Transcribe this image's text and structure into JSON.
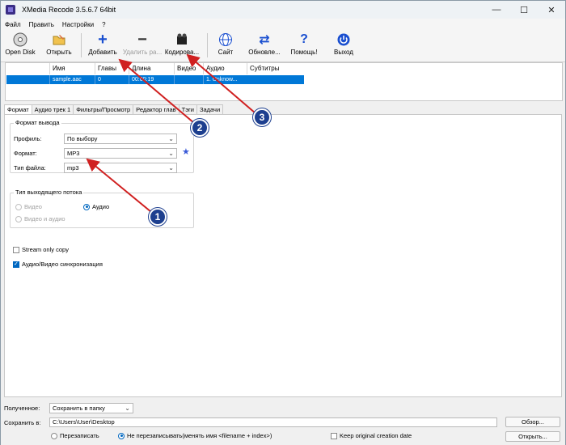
{
  "window": {
    "title": "XMedia Recode 3.5.6.7 64bit"
  },
  "menu": [
    "Файл",
    "Править",
    "Настройки",
    "?"
  ],
  "toolbar": {
    "open_disk": "Open Disk",
    "open": "Открыть",
    "add": "Добавить",
    "remove": "Удалить ра...",
    "encode": "Кодирова...",
    "site": "Сайт",
    "update": "Обновле...",
    "help": "Помощь!",
    "exit": "Выход"
  },
  "filelist": {
    "columns": [
      "Имя",
      "Главы",
      "Длина",
      "Видео",
      "Аудио",
      "Субтитры"
    ],
    "rows": [
      {
        "name": "sample.aac",
        "chapters": "0",
        "length": "00:00:19",
        "video": "",
        "audio": "1. Unknow..."
      }
    ]
  },
  "tabs": [
    "Формат",
    "Аудио трек 1",
    "Фильтры/Просмотр",
    "Редактор глав",
    "Тэги",
    "Задачи"
  ],
  "format_panel": {
    "output_group": "Формат вывода",
    "profile_label": "Профиль:",
    "profile_value": "По выбору",
    "format_label": "Формат:",
    "format_value": "MP3",
    "filetype_label": "Тип файла:",
    "filetype_value": "mp3",
    "stream_group": "Тип выходящего потока",
    "radio_video": "Видео",
    "radio_audio": "Аудио",
    "radio_video_audio": "Видео и аудио",
    "stream_only": "Stream only copy",
    "sync": "Аудио/Видео синхронизация"
  },
  "bottom": {
    "received_label": "Полученное:",
    "received_value": "Сохранить в папку",
    "save_label": "Сохранить в:",
    "save_path": "C:\\Users\\User\\Desktop",
    "browse": "Обзор...",
    "overwrite": "Перезаписать",
    "no_overwrite": "Не перезаписывать(менять имя <filename + index>)",
    "keep_date": "Keep original creation date",
    "open_btn": "Открыть..."
  },
  "annotations": [
    "1",
    "2",
    "3"
  ],
  "colors": {
    "selection": "#0078d7",
    "badge": "#1d3f8f",
    "arrow": "#d02020"
  }
}
